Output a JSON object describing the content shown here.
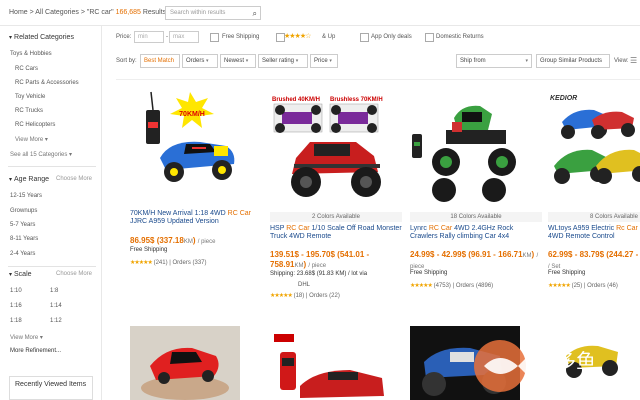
{
  "breadcrumb": {
    "home": "Home",
    "all_categories": "All Categories",
    "query": "\"RC car\"",
    "count": "166,685",
    "results": "Results"
  },
  "search": {
    "placeholder": "Search within results"
  },
  "sidebar": {
    "related_title": "Related Categories",
    "related_items": [
      "Toys & Hobbies",
      "RC Cars",
      "RC Parts & Accessories",
      "Toy Vehicle",
      "RC Trucks",
      "RC Helicopters"
    ],
    "view_more": "View More",
    "see_all": "See all 15 Categories",
    "age_title": "Age Range",
    "choose_more": "Choose More",
    "age_items": [
      "12-15 Years",
      "Grownups",
      "5-7 Years",
      "8-11 Years",
      "2-4 Years"
    ],
    "scale_title": "Scale",
    "scale_items": [
      "1:10",
      "1:8",
      "1:16",
      "1:14",
      "1:18",
      "1:12"
    ],
    "more_refinement": "More Refinement...",
    "recently_viewed": "Recently Viewed Items"
  },
  "filters": {
    "price_label": "Price:",
    "min_placeholder": "min",
    "max_placeholder": "max",
    "free_shipping": "Free Shipping",
    "stars": "★★★★☆",
    "and_up": "& Up",
    "app_only": "App Only deals",
    "domestic_returns": "Domestic Returns"
  },
  "sort": {
    "label": "Sort by:",
    "best_match": "Best Match",
    "orders": "Orders",
    "newest": "Newest",
    "seller_rating": "Seller rating",
    "price": "Price",
    "ship_from": "Ship from",
    "group_similar": "Group Similar Products",
    "view": "View:"
  },
  "products": [
    {
      "colors": "",
      "title_pre": "70KM/H New Arrival 1:18 4WD ",
      "title_hl": "RC Car",
      "title_post": " JJRC A959 Updated Version",
      "price": "86.95$ (337.18",
      "price_cur": "KM",
      "price_close": ")",
      "unit": "/ piece",
      "shipping": "Free Shipping",
      "stars": "★★★★★",
      "reviews": "(241)",
      "orders": "Orders (337)",
      "extra": "",
      "badge": "70KM/H"
    },
    {
      "colors": "2 Colors Available",
      "title_pre": "HSP ",
      "title_hl": "RC Car",
      "title_post": " 1/10 Scale Off Road Monster Truck 4WD Remote",
      "price": "139.51$ - 195.70$ (541.01 - 758.91",
      "price_cur": "KM",
      "price_close": ")",
      "unit": "/ piece",
      "shipping": "Shipping: 23.68$ (91.83 KM) / lot via",
      "carrier": "DHL",
      "stars": "★★★★★",
      "reviews": "(18)",
      "orders": "Orders (22)",
      "label_a": "Brushed 40KM/H",
      "label_b": "Brushless 70KM/H"
    },
    {
      "colors": "18 Colors Available",
      "title_pre": "Lynrc ",
      "title_hl": "RC Car",
      "title_post": " 4WD 2.4GHz Rock Crawlers Rally climbing Car 4x4",
      "price": "24.99$ - 42.99$ (96.91 - 166.71",
      "price_cur": "KM",
      "price_close": ")",
      "unit": "/ piece",
      "shipping": "Free Shipping",
      "stars": "★★★★★",
      "reviews": "(4753)",
      "orders": "Orders (4896)"
    },
    {
      "colors": "8 Colors Available",
      "title_pre": "WLtoys A959 Electric ",
      "title_hl": "Rc Car",
      "title_post": " 1/18 2.4Ghz 4WD Remote Control",
      "price": "62.99$ - 83.79$ (244.27 - 324.93",
      "price_cur": "KM",
      "price_close": ")",
      "unit": "/ Set",
      "shipping": "Free Shipping",
      "stars": "★★★★★",
      "reviews": "(25)",
      "orders": "Orders (46)",
      "brand": "KEDIOR"
    }
  ],
  "watermark": {
    "cn": "网多鱼",
    "url": "wduoyu.com"
  },
  "colors": {
    "accent": "#e46f00",
    "link": "#1a4a8c",
    "star": "#f0a400"
  }
}
